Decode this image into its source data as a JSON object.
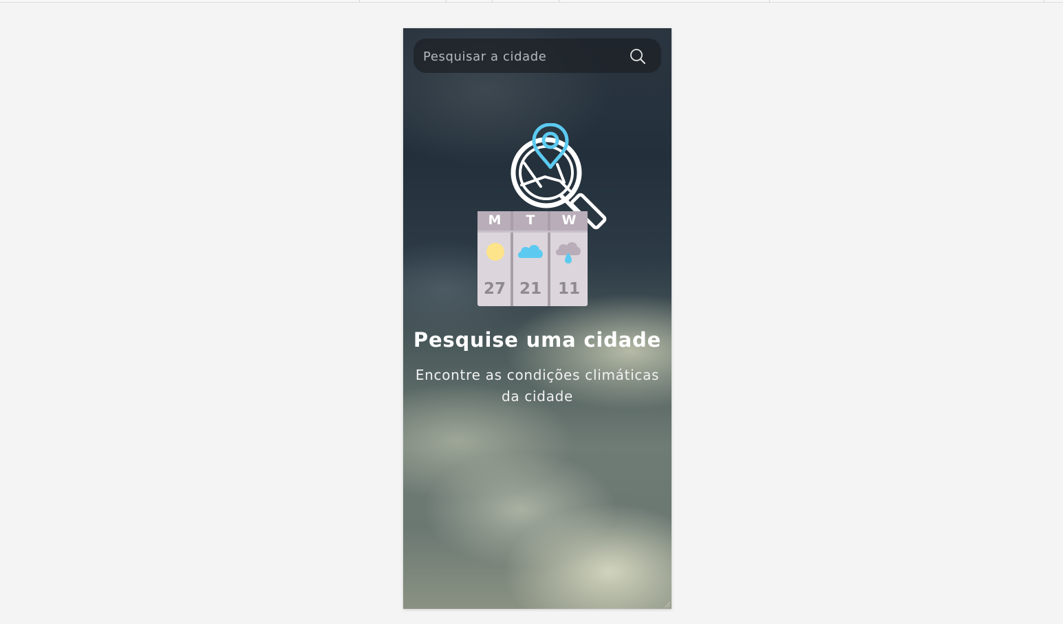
{
  "search": {
    "placeholder": "Pesquisar a cidade",
    "value": "",
    "icon": "search-icon"
  },
  "empty_state": {
    "title": "Pesquise uma cidade",
    "subtitle_line1": "Encontre as condições climáticas",
    "subtitle_line2": "da cidade"
  },
  "illustration": {
    "days": [
      {
        "letter": "M",
        "icon": "sun-icon",
        "temp": "27"
      },
      {
        "letter": "T",
        "icon": "cloud-icon",
        "temp": "21"
      },
      {
        "letter": "W",
        "icon": "rain-cloud-icon",
        "temp": "11"
      }
    ]
  },
  "colors": {
    "page_background": "#f4f4f4",
    "accent_blue": "#5ccaf0",
    "sun_yellow": "#fde38a",
    "calendar_body": "#dcd6dc",
    "calendar_header": "#b8adb8"
  }
}
